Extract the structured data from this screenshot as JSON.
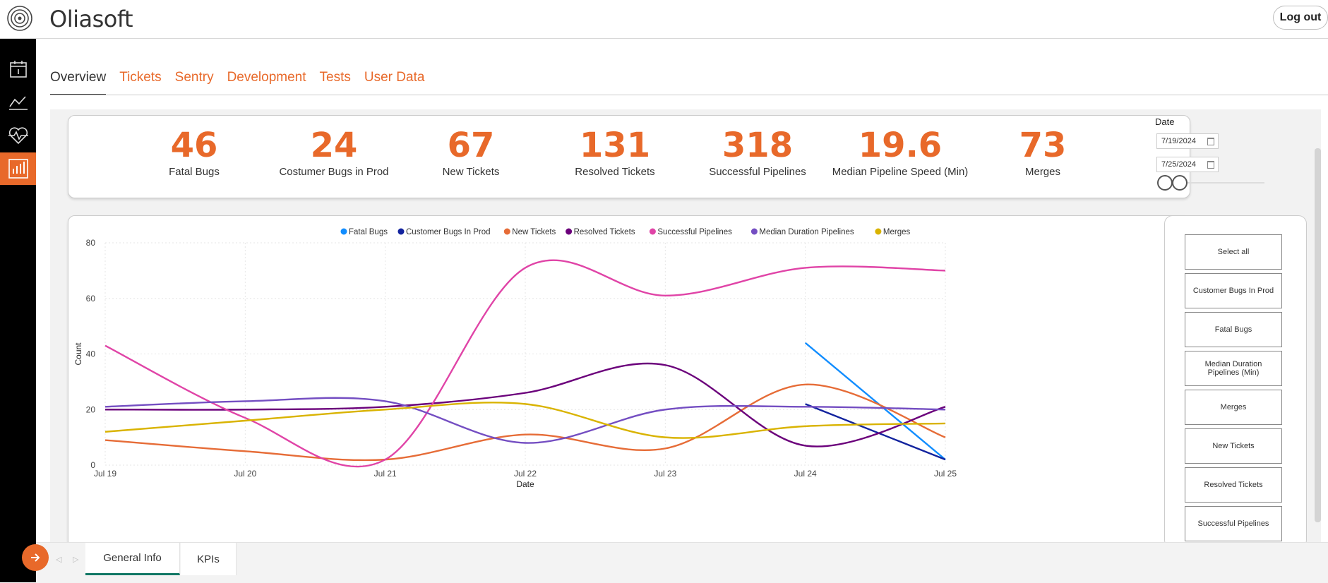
{
  "header": {
    "brand": "Oliasoft",
    "logout_label": "Log out"
  },
  "sidebar": {
    "items": [
      {
        "icon": "calendar-icon"
      },
      {
        "icon": "line-chart-icon"
      },
      {
        "icon": "heartbeat-icon"
      },
      {
        "icon": "bar-chart-icon",
        "active": true
      }
    ]
  },
  "tabs": [
    "Overview",
    "Tickets",
    "Sentry",
    "Development",
    "Tests",
    "User Data"
  ],
  "kpis": [
    {
      "value": "46",
      "label": "Fatal Bugs"
    },
    {
      "value": "24",
      "label": "Costumer Bugs in Prod"
    },
    {
      "value": "67",
      "label": "New Tickets"
    },
    {
      "value": "131",
      "label": "Resolved Tickets"
    },
    {
      "value": "318",
      "label": "Successful Pipelines"
    },
    {
      "value": "19.6",
      "label": "Median Pipeline Speed (Min)"
    },
    {
      "value": "73",
      "label": "Merges"
    }
  ],
  "date_filter": {
    "label": "Date",
    "start": "7/19/2024",
    "end": "7/25/2024"
  },
  "slicer": {
    "items": [
      "Select all",
      "Customer Bugs In Prod",
      "Fatal Bugs",
      "Median Duration Pipelines (Min)",
      "Merges",
      "New Tickets",
      "Resolved Tickets",
      "Successful Pipelines"
    ]
  },
  "bottom": {
    "pages": [
      "General Info",
      "KPIs"
    ]
  },
  "colors": {
    "accent": "#e8692a",
    "sidebar": "#000000",
    "page_tab_underline": "#117865"
  },
  "chart_data": {
    "type": "line",
    "xlabel": "Date",
    "ylabel": "Count",
    "ylim": [
      0,
      80
    ],
    "yticks": [
      0,
      20,
      40,
      60,
      80
    ],
    "x": [
      "Jul 19",
      "Jul 20",
      "Jul 21",
      "Jul 22",
      "Jul 23",
      "Jul 24",
      "Jul 25"
    ],
    "grid": true,
    "legend": "top-center",
    "series": [
      {
        "name": "Fatal Bugs",
        "color": "#118dff",
        "values": [
          null,
          null,
          null,
          null,
          null,
          44,
          2
        ]
      },
      {
        "name": "Customer Bugs In Prod",
        "color": "#12239e",
        "values": [
          null,
          null,
          null,
          null,
          null,
          22,
          2
        ]
      },
      {
        "name": "New Tickets",
        "color": "#e66c37",
        "values": [
          9,
          5,
          2,
          11,
          6,
          29,
          10
        ]
      },
      {
        "name": "Resolved Tickets",
        "color": "#6b007b",
        "values": [
          20,
          20,
          21,
          26,
          36,
          7,
          21
        ]
      },
      {
        "name": "Successful Pipelines",
        "color": "#e044a7",
        "values": [
          43,
          17,
          2,
          71,
          61,
          71,
          70
        ]
      },
      {
        "name": "Median Duration Pipelines",
        "color": "#744ec2",
        "values": [
          21,
          23,
          23,
          8,
          20,
          21,
          20
        ]
      },
      {
        "name": "Merges",
        "color": "#d9b300",
        "values": [
          12,
          16,
          20,
          22,
          10,
          14,
          15
        ]
      }
    ]
  }
}
